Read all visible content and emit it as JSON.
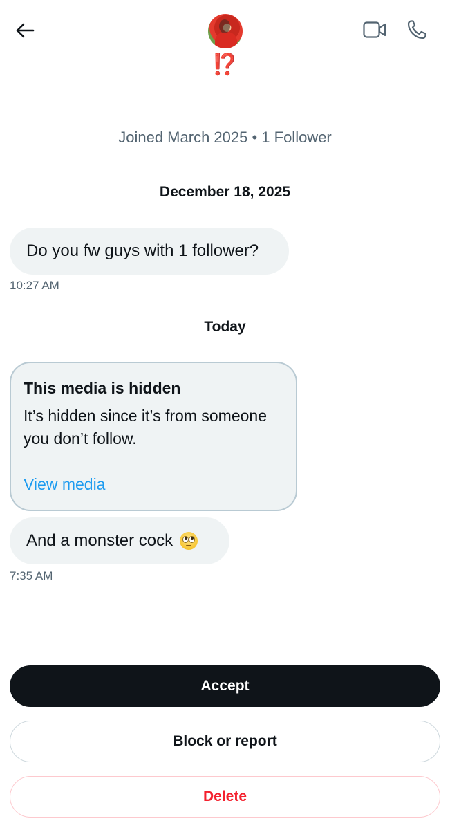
{
  "header": {
    "back_icon": "back-arrow-icon",
    "display_name": "⁉️",
    "video_icon": "video-call-icon",
    "phone_icon": "phone-call-icon"
  },
  "profile": {
    "meta": "Joined March 2025 • 1 Follower"
  },
  "conversation": {
    "date_1": "December 18, 2025",
    "message_1": "Do you fw guys with 1 follower?",
    "time_1": "10:27 AM",
    "date_2": "Today",
    "hidden_media": {
      "title": "This media is hidden",
      "description": "It’s hidden since it’s from someone\nyou don’t follow.",
      "link": "View media"
    },
    "message_2": "And a monster cock",
    "message_2_emoji": "face-with-rolling-eyes",
    "time_2": "7:35 AM"
  },
  "actions": {
    "accept": "Accept",
    "block_report": "Block or report",
    "delete": "Delete"
  },
  "colors": {
    "accent": "#1d9bf0",
    "danger": "#f4212e",
    "bubble": "#eff3f4",
    "text": "#0f1419",
    "secondary": "#536471"
  }
}
